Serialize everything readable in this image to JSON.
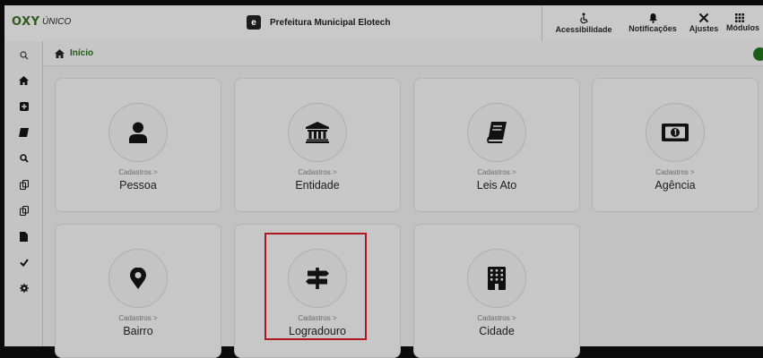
{
  "app": {
    "logo": "OXY",
    "logo_sub": "ÚNICO",
    "org_mark": "e",
    "org_name": "Prefeitura Municipal Elotech"
  },
  "toolbar": {
    "items": [
      {
        "label": "Acessibilidade",
        "icon": "accessibility-icon"
      },
      {
        "label": "Notificações",
        "icon": "bell-icon"
      },
      {
        "label": "Ajustes",
        "icon": "tools-icon"
      },
      {
        "label": "Módulos",
        "icon": "grid-icon"
      }
    ]
  },
  "sidebar": {
    "items": [
      {
        "icon": "search-icon"
      },
      {
        "icon": "home-icon"
      },
      {
        "icon": "plus-square-icon"
      },
      {
        "icon": "book-icon"
      },
      {
        "icon": "search-icon"
      },
      {
        "icon": "copy-icon"
      },
      {
        "icon": "copy-icon"
      },
      {
        "icon": "file-icon"
      },
      {
        "icon": "check-icon"
      },
      {
        "icon": "gear-icon"
      }
    ]
  },
  "breadcrumb": {
    "label": "Início"
  },
  "cards": [
    {
      "section": "Cadastros >",
      "title": "Pessoa",
      "icon": "user-icon"
    },
    {
      "section": "Cadastros >",
      "title": "Entidade",
      "icon": "institution-icon"
    },
    {
      "section": "Cadastros >",
      "title": "Leis Ato",
      "icon": "book-icon"
    },
    {
      "section": "Cadastros >",
      "title": "Agência",
      "icon": "money-bill-icon"
    },
    {
      "section": "Cadastros >",
      "title": "Bairro",
      "icon": "map-pin-icon"
    },
    {
      "section": "Cadastros >",
      "title": "Logradouro",
      "icon": "signpost-icon"
    },
    {
      "section": "Cadastros >",
      "title": "Cidade",
      "icon": "building-icon"
    }
  ],
  "colors": {
    "accent": "#1f5c12",
    "highlight": "#b0161c"
  }
}
